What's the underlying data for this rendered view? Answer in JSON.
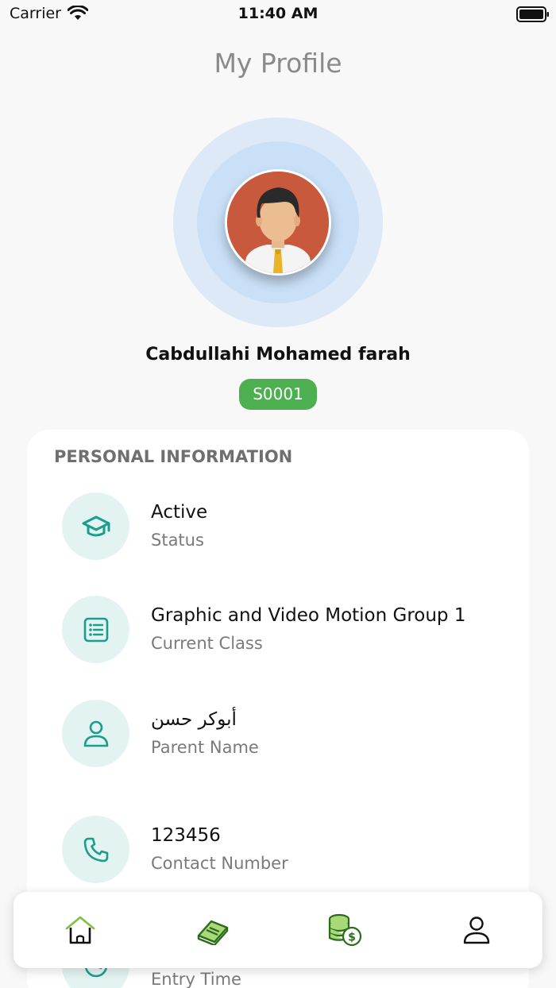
{
  "status_bar": {
    "carrier": "Carrier",
    "time": "11:40 AM"
  },
  "header": {
    "title": "My Profile"
  },
  "profile": {
    "name": "Cabdullahi Mohamed farah",
    "student_id": "S0001"
  },
  "personal_info": {
    "section_title": "PERSONAL INFORMATION",
    "rows": [
      {
        "value": "Active",
        "label": "Status",
        "icon": "graduation-cap-icon"
      },
      {
        "value": "Graphic and Video Motion Group 1",
        "label": "Current Class",
        "icon": "list-icon"
      },
      {
        "value": "أبوكر حسن",
        "label": "Parent Name",
        "icon": "person-icon"
      },
      {
        "value": "123456",
        "label": "Contact Number",
        "icon": "phone-icon"
      },
      {
        "value": "",
        "label": "Entry Time",
        "icon": "clock-icon"
      }
    ]
  },
  "bottom_nav": {
    "items": [
      {
        "icon": "home-icon"
      },
      {
        "icon": "book-icon"
      },
      {
        "icon": "coins-icon"
      },
      {
        "icon": "profile-icon"
      }
    ]
  },
  "colors": {
    "accent": "#1a9e8c",
    "badge": "#4caf50",
    "nav_green": "#7cc242",
    "avatar_bg": "#c9593d"
  }
}
